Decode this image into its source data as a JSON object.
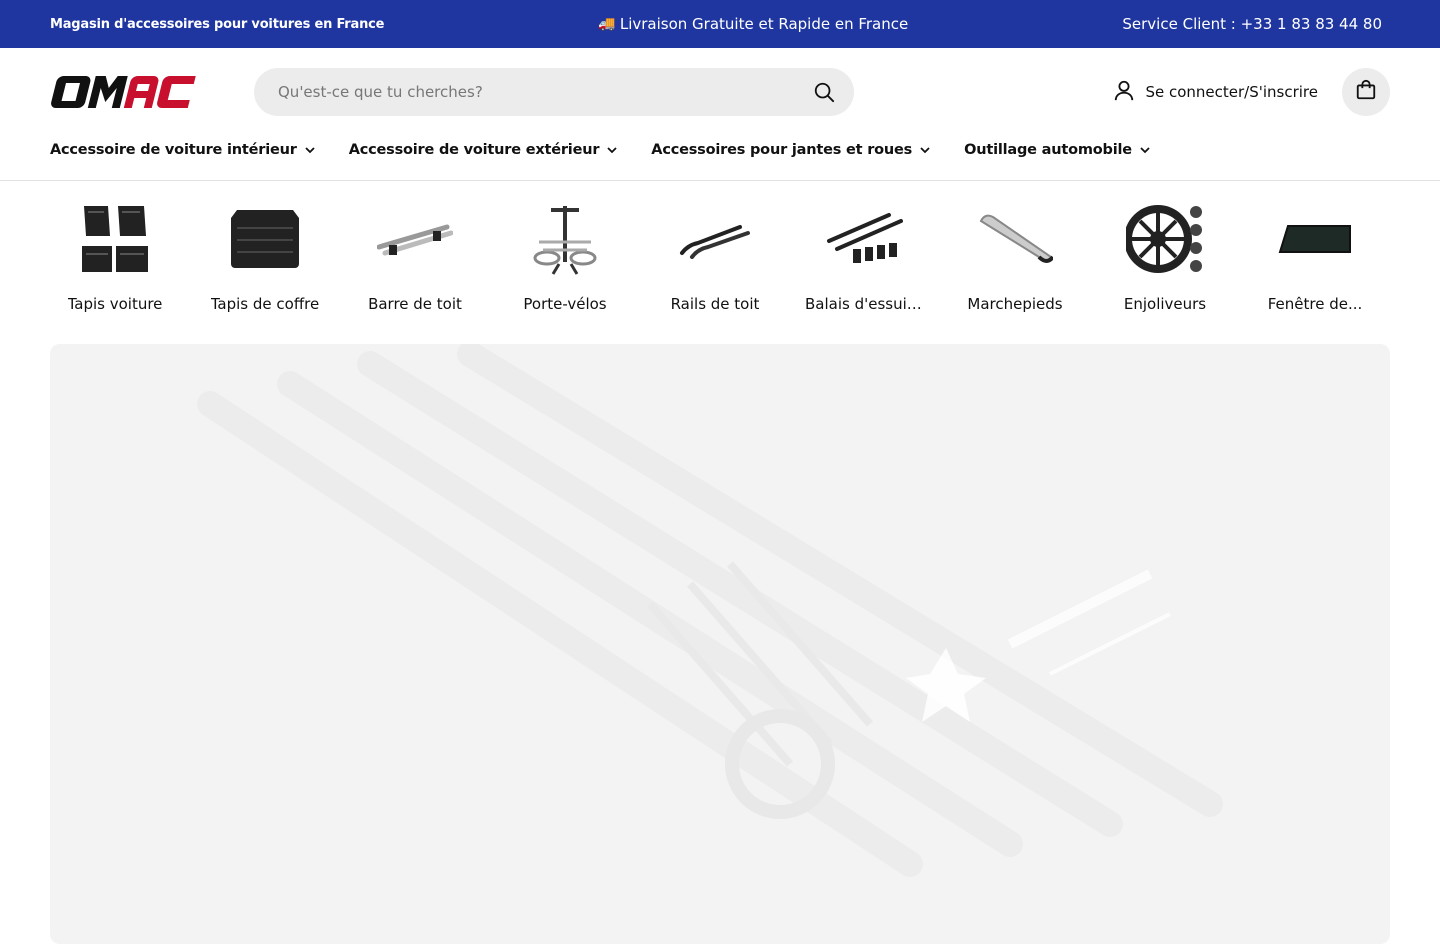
{
  "topbar": {
    "left": "Magasin d'accessoires pour voitures en France",
    "center_icon": "truck-emoji",
    "center": "Livraison Gratuite et Rapide en France",
    "right": "Service Client : +33 1 83 83 44 80",
    "bg_color": "#1f36a0"
  },
  "header": {
    "logo_text": "OMAC",
    "search_placeholder": "Qu'est-ce que tu cherches?",
    "account_label": "Se connecter/S'inscrire"
  },
  "nav": {
    "items": [
      {
        "label": "Accessoire de voiture intérieur"
      },
      {
        "label": "Accessoire de voiture extérieur"
      },
      {
        "label": "Accessoires pour jantes et roues"
      },
      {
        "label": "Outillage automobile"
      }
    ]
  },
  "categories": [
    {
      "label": "Tapis voiture",
      "icon": "floor-mats-icon"
    },
    {
      "label": "Tapis de coffre",
      "icon": "trunk-mat-icon"
    },
    {
      "label": "Barre de toit",
      "icon": "roof-bar-icon"
    },
    {
      "label": "Porte-vélos",
      "icon": "bike-carrier-icon"
    },
    {
      "label": "Rails de toit",
      "icon": "roof-rails-icon"
    },
    {
      "label": "Balais d'essuie-glace",
      "icon": "wiper-blades-icon"
    },
    {
      "label": "Marchepieds",
      "icon": "running-board-icon"
    },
    {
      "label": "Enjoliveurs",
      "icon": "hubcap-icon"
    },
    {
      "label": "Fenêtre de...",
      "icon": "window-icon"
    }
  ],
  "colors": {
    "accent": "#1f36a0",
    "logo_red": "#c8102e"
  }
}
